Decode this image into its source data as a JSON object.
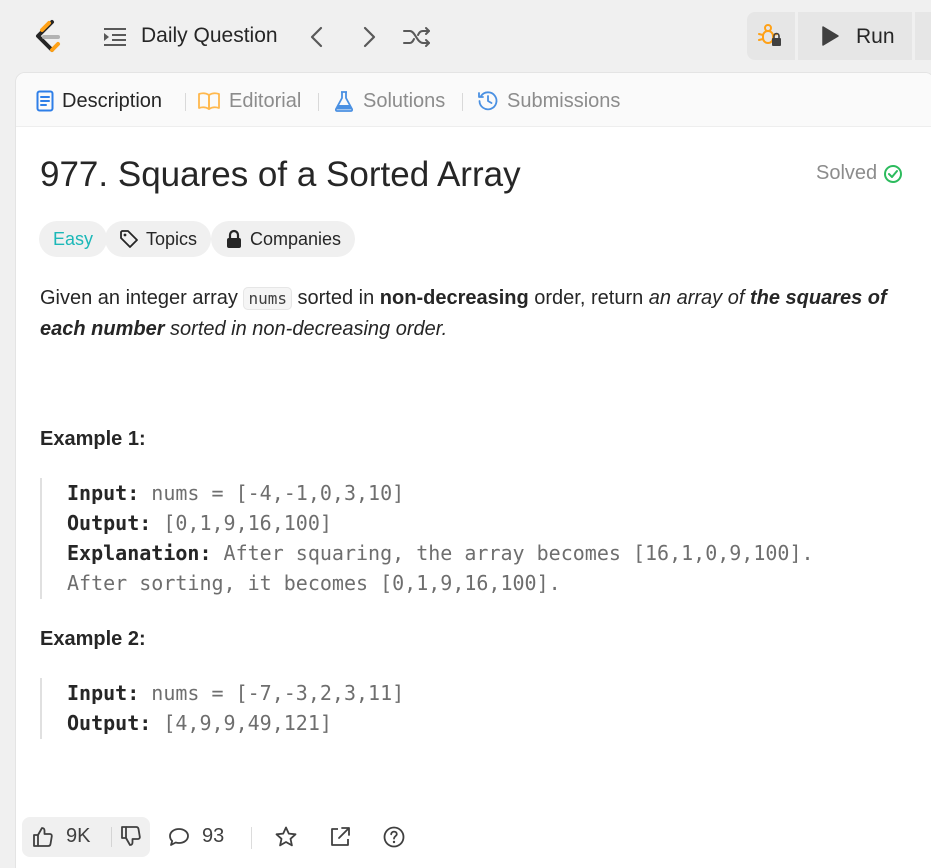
{
  "topbar": {
    "daily_label": "Daily Question",
    "run_label": "Run"
  },
  "tabs": [
    {
      "label": "Description",
      "active": true
    },
    {
      "label": "Editorial",
      "active": false
    },
    {
      "label": "Solutions",
      "active": false
    },
    {
      "label": "Submissions",
      "active": false
    }
  ],
  "problem": {
    "title": "977. Squares of a Sorted Array",
    "status": "Solved",
    "difficulty": "Easy",
    "topics_label": "Topics",
    "companies_label": "Companies",
    "desc": {
      "p1": "Given an integer array ",
      "code": "nums",
      "p2": " sorted in ",
      "b1": "non-decreasing",
      "p3": " order, return ",
      "i1": "an array of ",
      "bi": "the squares of each number",
      "i2": " sorted in non-decreasing order."
    }
  },
  "examples": [
    {
      "heading": "Example 1:",
      "input_label": "Input:",
      "input": "nums = [-4,-1,0,3,10]",
      "output_label": "Output:",
      "output": "[0,1,9,16,100]",
      "explanation_label": "Explanation:",
      "explanation": "After squaring, the array becomes [16,1,0,9,100].",
      "explanation2": "After sorting, it becomes [0,1,9,16,100]."
    },
    {
      "heading": "Example 2:",
      "input_label": "Input:",
      "input": "nums = [-7,-3,2,3,11]",
      "output_label": "Output:",
      "output": "[4,9,9,49,121]"
    }
  ],
  "bottom": {
    "likes": "9K",
    "comments": "93"
  },
  "colors": {
    "easy": "#1cb8b8",
    "solved_check": "#2cbb5d",
    "logo_orange": "#ffa116"
  }
}
